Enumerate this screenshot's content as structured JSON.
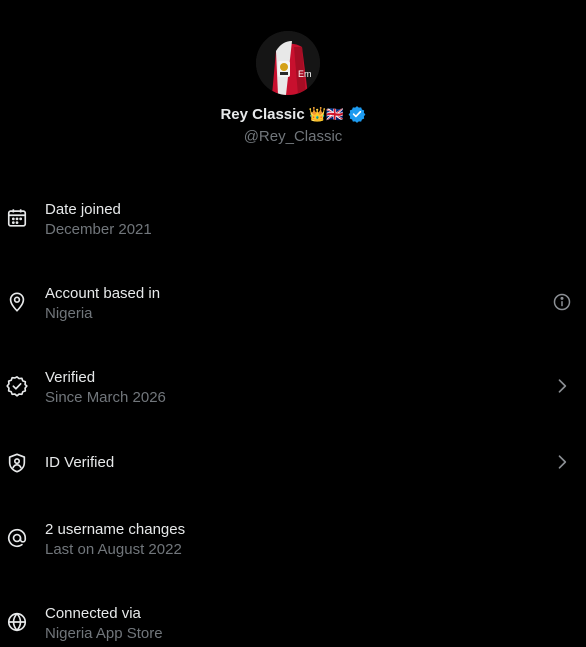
{
  "profile": {
    "display_name": "Rey Classic",
    "name_emojis": "👑🇬🇧",
    "verified_badge_color": "#1d9bf0",
    "handle": "@Rey_Classic"
  },
  "rows": [
    {
      "icon": "calendar-icon",
      "title": "Date joined",
      "subtitle": "December 2021",
      "trailing": null
    },
    {
      "icon": "location-pin-icon",
      "title": "Account based in",
      "subtitle": "Nigeria",
      "trailing": "info-icon"
    },
    {
      "icon": "verified-badge-icon",
      "title": "Verified",
      "subtitle": "Since March 2026",
      "trailing": "chevron-right-icon"
    },
    {
      "icon": "id-shield-icon",
      "title": "ID Verified",
      "subtitle": "",
      "trailing": "chevron-right-icon"
    },
    {
      "icon": "at-sign-icon",
      "title": "2 username changes",
      "subtitle": "Last on August 2022",
      "trailing": null
    },
    {
      "icon": "globe-icon",
      "title": "Connected via",
      "subtitle": "Nigeria App Store",
      "trailing": null
    }
  ],
  "colors": {
    "background": "#000000",
    "primary_text": "#e7e9ea",
    "secondary_text": "#71767b"
  }
}
